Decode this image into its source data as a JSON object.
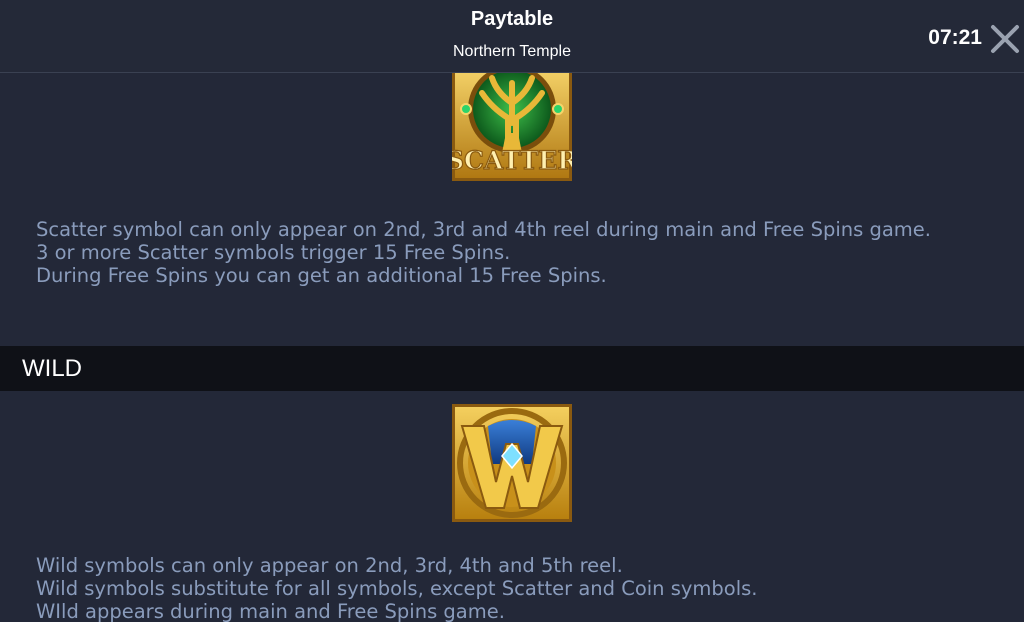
{
  "header": {
    "title": "Paytable",
    "subtitle": "Northern Temple",
    "clock": "07:21",
    "close_icon": "close-icon"
  },
  "scatter": {
    "icon": "scatter-symbol-icon",
    "icon_text": "SCATTER",
    "lines": [
      "Scatter symbol can only appear on 2nd, 3rd and 4th reel during main and Free Spins game.",
      "3 or more Scatter symbols trigger 15 Free Spins.",
      "During Free Spins you can get an additional 15 Free Spins."
    ]
  },
  "wild": {
    "section_title": "WILD",
    "icon": "wild-symbol-icon",
    "lines": [
      "Wild symbols can only appear on 2nd, 3rd, 4th and 5th reel.",
      "Wild symbols substitute for all symbols, except Scatter and Coin symbols.",
      "WIld appears during main and Free Spins game."
    ]
  },
  "colors": {
    "background": "#232838",
    "section_header_bg": "#0f1117",
    "description_text": "#8a9cbc",
    "gold": "#d9a520"
  }
}
